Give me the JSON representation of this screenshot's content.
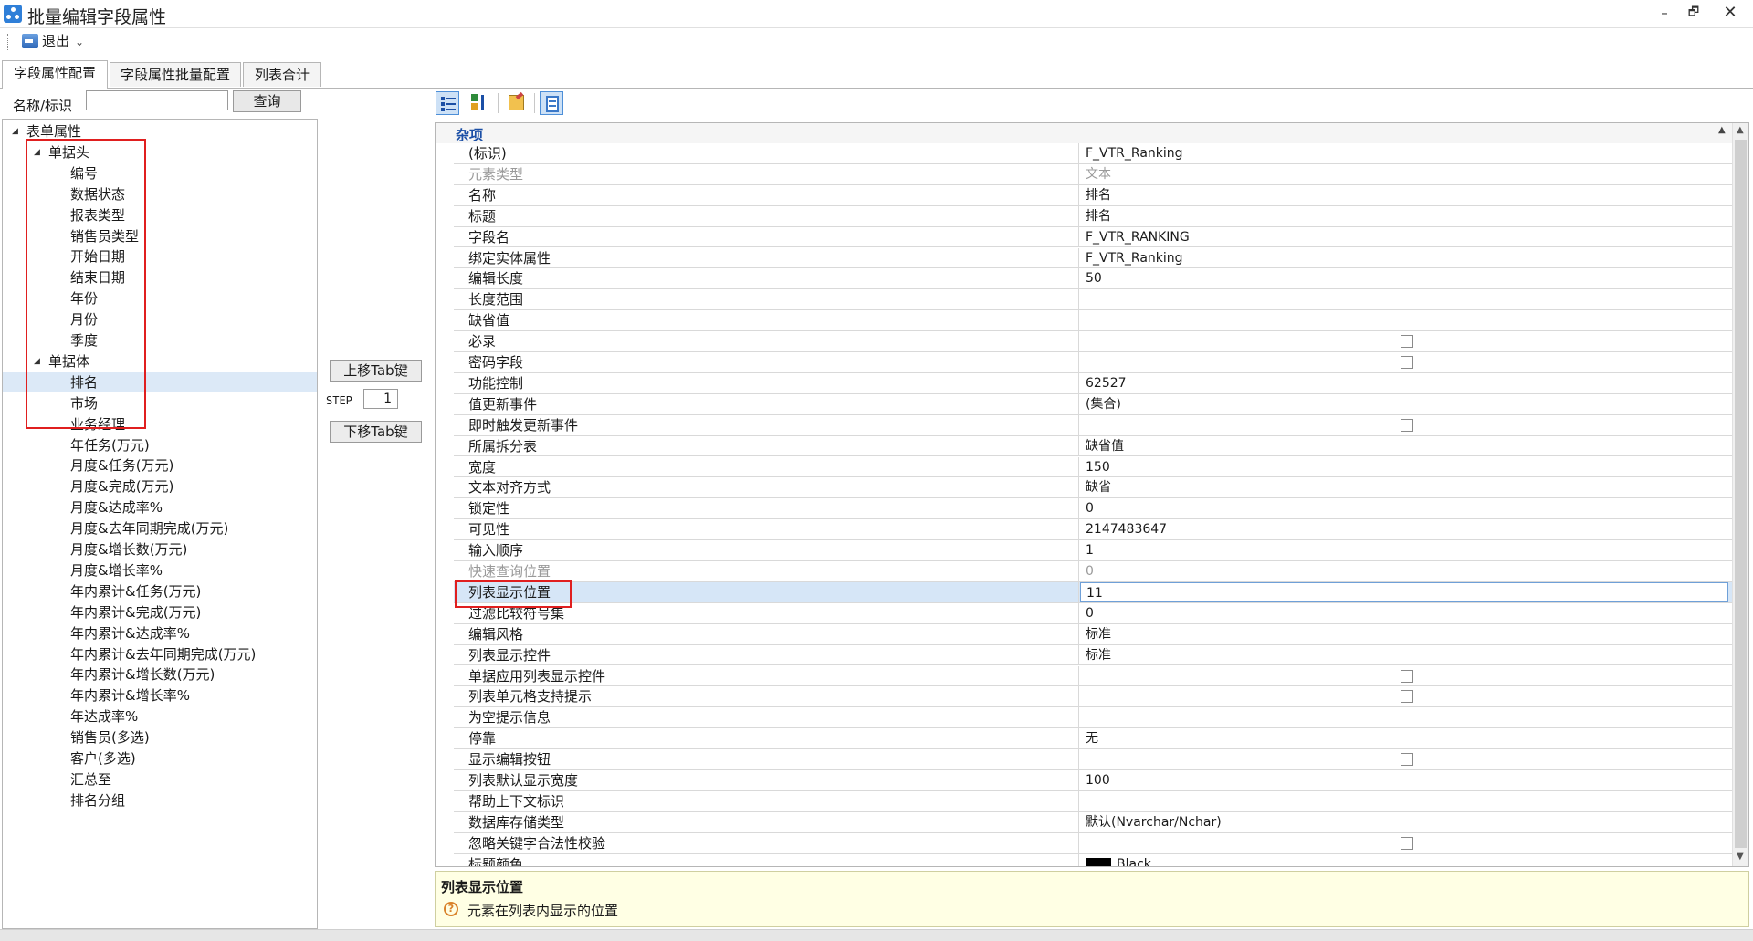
{
  "window": {
    "title": "批量编辑字段属性",
    "minimize": "–",
    "restore": "🗗",
    "close": "✕"
  },
  "toolbar": {
    "exit_label": "退出",
    "exit_arrow": "⌄"
  },
  "tabs": [
    {
      "label": "字段属性配置",
      "active": true
    },
    {
      "label": "字段属性批量配置",
      "active": false
    },
    {
      "label": "列表合计",
      "active": false
    }
  ],
  "search": {
    "label": "名称/标识",
    "value": "",
    "button": "查询"
  },
  "tree": {
    "root": "表单属性",
    "groups": [
      {
        "label": "单据头",
        "items": [
          "编号",
          "数据状态",
          "报表类型",
          "销售员类型",
          "开始日期",
          "结束日期",
          "年份",
          "月份",
          "季度"
        ]
      },
      {
        "label": "单据体",
        "items": [
          "排名",
          "市场",
          "业务经理",
          "年任务(万元)",
          "月度&任务(万元)",
          "月度&完成(万元)",
          "月度&达成率%",
          "月度&去年同期完成(万元)",
          "月度&增长数(万元)",
          "月度&增长率%",
          "年内累计&任务(万元)",
          "年内累计&完成(万元)",
          "年内累计&达成率%",
          "年内累计&去年同期完成(万元)",
          "年内累计&增长数(万元)",
          "年内累计&增长率%",
          "年达成率%",
          "销售员(多选)",
          "客户(多选)",
          "汇总至",
          "排名分组"
        ]
      }
    ],
    "selected": "排名"
  },
  "tab_move": {
    "up": "上移Tab键",
    "down": "下移Tab键",
    "step_label": "STEP",
    "step_value": "1"
  },
  "property_grid": {
    "category": "杂项",
    "rows": [
      {
        "name": "(标识)",
        "value": "F_VTR_Ranking"
      },
      {
        "name": "元素类型",
        "value": "文本",
        "disabled": true
      },
      {
        "name": "名称",
        "value": "排名"
      },
      {
        "name": "标题",
        "value": "排名"
      },
      {
        "name": "字段名",
        "value": "F_VTR_RANKING"
      },
      {
        "name": "绑定实体属性",
        "value": "F_VTR_Ranking"
      },
      {
        "name": "编辑长度",
        "value": "50"
      },
      {
        "name": "长度范围",
        "value": ""
      },
      {
        "name": "缺省值",
        "value": ""
      },
      {
        "name": "必录",
        "checkbox": true
      },
      {
        "name": "密码字段",
        "checkbox": true
      },
      {
        "name": "功能控制",
        "value": "62527"
      },
      {
        "name": "值更新事件",
        "value": "(集合)"
      },
      {
        "name": "即时触发更新事件",
        "checkbox": true
      },
      {
        "name": "所属拆分表",
        "value": "缺省值"
      },
      {
        "name": "宽度",
        "value": "150"
      },
      {
        "name": "文本对齐方式",
        "value": "缺省"
      },
      {
        "name": "锁定性",
        "value": "0"
      },
      {
        "name": "可见性",
        "value": "2147483647"
      },
      {
        "name": "输入顺序",
        "value": "1"
      },
      {
        "name": "快速查询位置",
        "value": "0",
        "disabled": true
      },
      {
        "name": "列表显示位置",
        "value": "11",
        "selected": true
      },
      {
        "name": "过滤比较符号集",
        "value": "0"
      },
      {
        "name": "编辑风格",
        "value": "标准"
      },
      {
        "name": "列表显示控件",
        "value": "标准"
      },
      {
        "name": "单据应用列表显示控件",
        "checkbox": true
      },
      {
        "name": "列表单元格支持提示",
        "checkbox": true
      },
      {
        "name": "为空提示信息",
        "value": ""
      },
      {
        "name": "停靠",
        "value": "无"
      },
      {
        "name": "显示编辑按钮",
        "checkbox": true
      },
      {
        "name": "列表默认显示宽度",
        "value": "100"
      },
      {
        "name": "帮助上下文标识",
        "value": ""
      },
      {
        "name": "数据库存储类型",
        "value": "默认(Nvarchar/Nchar)"
      },
      {
        "name": "忽略关键字合法性校验",
        "checkbox": true
      },
      {
        "name": "标题颜色",
        "value": "Black",
        "swatch": "#000000"
      }
    ]
  },
  "help": {
    "title": "列表显示位置",
    "description": "元素在列表内显示的位置"
  },
  "colors": {
    "accent": "#2f7fd8",
    "highlight_border": "#e01f1f",
    "selection": "#d6e6f7",
    "help_bg": "#ffffe4"
  }
}
